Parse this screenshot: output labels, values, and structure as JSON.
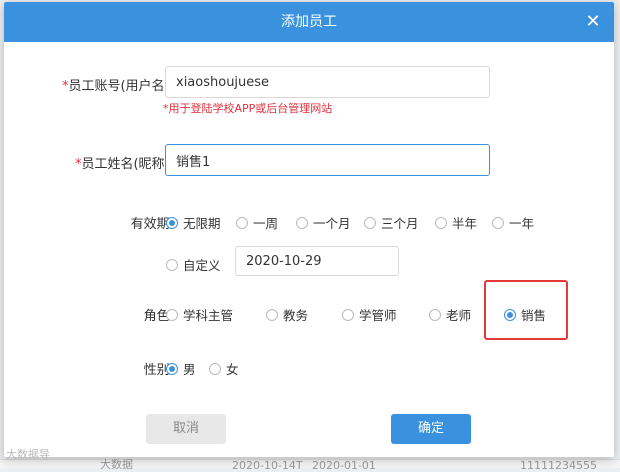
{
  "dialog": {
    "title": "添加员工",
    "close_glyph": "✕"
  },
  "form": {
    "account": {
      "required_mark": "*",
      "label": "员工账号(用户名):",
      "value": "xiaoshoujuese",
      "hint": "*用于登陆学校APP或后台管理网站"
    },
    "name": {
      "required_mark": "*",
      "label": "员工姓名(昵称):",
      "value": "销售1"
    },
    "validity": {
      "label": "有效期:",
      "options": [
        "无限期",
        "一周",
        "一个月",
        "三个月",
        "半年",
        "一年",
        "自定义"
      ],
      "selected": "无限期",
      "custom_date": "2020-10-29"
    },
    "role": {
      "label": "角色:",
      "options": [
        "学科主管",
        "教务",
        "学管师",
        "老师",
        "销售"
      ],
      "selected": "销售"
    },
    "gender": {
      "label": "性别:",
      "options": [
        "男",
        "女"
      ],
      "selected": "男"
    }
  },
  "buttons": {
    "cancel": "取消",
    "confirm": "确定"
  },
  "watermark": "大数据导",
  "background_row": [
    "大数据",
    "2020-10-14T",
    "2020-01-01",
    "11111234555"
  ]
}
